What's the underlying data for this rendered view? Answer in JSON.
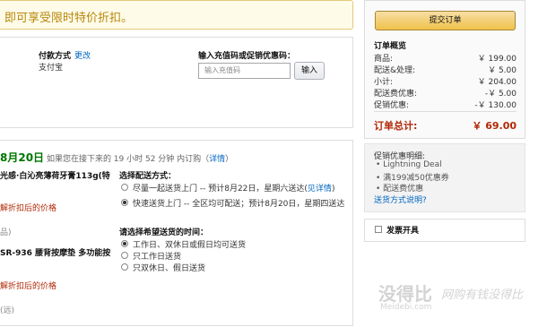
{
  "banner": {
    "text": "即可享受限时特价折扣。"
  },
  "payment": {
    "label": "付款方式",
    "change_link": "更改",
    "method": "支付宝"
  },
  "promo": {
    "label": "输入充值码或促销优惠码：",
    "placeholder": "输入充值码",
    "apply_button": "输入"
  },
  "delivery": {
    "date": "8月20日",
    "notice": "如果您在接下来的 19 小时 52 分钟 内订购（",
    "details_link": "详情",
    "notice_end": "）",
    "shipping_title": "选择配送方式：",
    "shipping_options": [
      {
        "text": "尽量一起送货上门 -- 预计8月22日，星期六送达(",
        "link": "见详情",
        "end": ")",
        "selected": false
      },
      {
        "text": "快速送货上门 -- 全区均可配送；预计8月20日，星期四送达",
        "link": "",
        "end": "",
        "selected": true
      }
    ],
    "time_title": "请选择希望送货的时间：",
    "time_options": [
      {
        "text": "工作日、双休日或假日均可送货",
        "selected": true
      },
      {
        "text": "只工作日送货",
        "selected": false
      },
      {
        "text": "只双休日、假日送货",
        "selected": false
      }
    ]
  },
  "items": [
    {
      "name": "光感·白沁亮薄荷牙膏113g(特",
      "price_note": "解折扣后的价格",
      "seller": "品)"
    },
    {
      "name": "SR-936 腰背按摩垫 多功能按",
      "price_note": "解折扣后的价格",
      "seller": "(远)"
    }
  ],
  "summary": {
    "submit_button": "提交订单",
    "title": "订单概览",
    "rows": [
      {
        "label": "商品:",
        "value": "￥ 199.00"
      },
      {
        "label": "配送&处理:",
        "value": "￥ 5.00"
      },
      {
        "label": "小计:",
        "value": "￥ 204.00"
      },
      {
        "label": "配送费优惠:",
        "value": "-￥ 5.00"
      },
      {
        "label": "促销优惠:",
        "value": "-￥ 130.00"
      }
    ],
    "total_label": "订单总计:",
    "total_value": "￥ 69.00"
  },
  "promo_info": {
    "title": "促销优惠明细:",
    "items": [
      "Lightning Deal",
      "满199减50优惠券",
      "配送费优惠"
    ],
    "link": "送货方式说明?"
  },
  "invoice": {
    "label": "发票开具"
  },
  "watermark": {
    "brand": "没得比",
    "site": "Meidebi.com",
    "slogan": "网购有钱没得比"
  },
  "colors": {
    "accent": "#b12704",
    "link": "#0066c0",
    "banner_text": "#b8860b",
    "button": "#f0c14b"
  }
}
